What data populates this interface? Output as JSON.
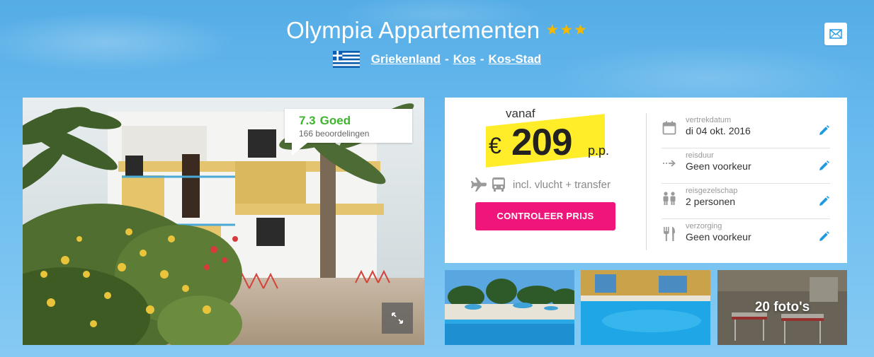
{
  "header": {
    "hotel_name": "Olympia Appartementen",
    "stars": "★★★",
    "star_count": 3,
    "location": [
      {
        "label": "Griekenland"
      },
      {
        "label": "Kos"
      },
      {
        "label": "Kos-Stad"
      }
    ],
    "separator": "-"
  },
  "rating": {
    "score": "7.3",
    "label": "Goed",
    "count": "166 beoordelingen"
  },
  "price": {
    "from_label": "vanaf",
    "currency": "€",
    "amount": "209",
    "per_person": "p.p.",
    "includes": "incl. vlucht + transfer",
    "button": "CONTROLEER PRIJS"
  },
  "details": [
    {
      "label": "vertrekdatum",
      "value": "di 04 okt. 2016",
      "icon": "calendar-icon"
    },
    {
      "label": "reisduur",
      "value": "Geen voorkeur",
      "icon": "duration-arrow-icon"
    },
    {
      "label": "reisgezelschap",
      "value": "2 personen",
      "icon": "people-icon"
    },
    {
      "label": "verzorging",
      "value": "Geen voorkeur",
      "icon": "cutlery-icon"
    }
  ],
  "gallery": {
    "photo_count": "20 foto's"
  },
  "colors": {
    "accent_pink": "#f0157a",
    "price_highlight": "#ffed2a",
    "rating_green": "#3fb52e",
    "star_gold": "#f5b800",
    "edit_blue": "#1e9be0"
  }
}
